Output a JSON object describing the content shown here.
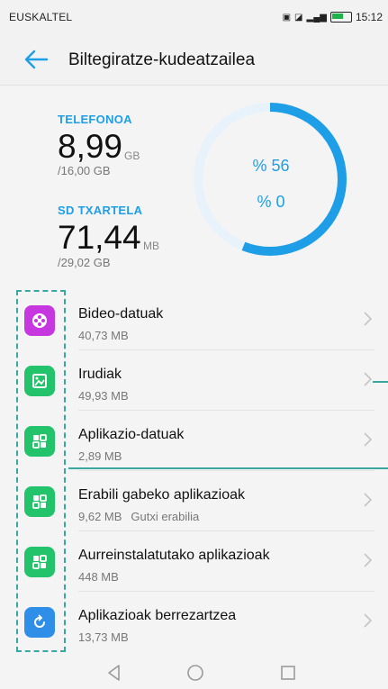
{
  "status_bar": {
    "carrier": "EUSKALTEL",
    "time": "15:12"
  },
  "app_bar": {
    "title": "Biltegiratze-kudeatzailea"
  },
  "storage": {
    "phone": {
      "label": "TELEFONOA",
      "used": "8,99",
      "unit": "GB",
      "total": "/16,00 GB",
      "percent_text": "% 56",
      "percent": 56
    },
    "sd": {
      "label": "SD TXARTELA",
      "used": "71,44",
      "unit": "MB",
      "total": "/29,02 GB",
      "percent_text": "% 0",
      "percent": 0
    }
  },
  "items": [
    {
      "name": "Bideo-datuak",
      "size": "40,73 MB",
      "extra": "",
      "icon": "video-icon",
      "color": "#c637e0"
    },
    {
      "name": "Irudiak",
      "size": "49,93 MB",
      "extra": "",
      "icon": "image-icon",
      "color": "#22c36a"
    },
    {
      "name": "Aplikazio-datuak",
      "size": "2,89 MB",
      "extra": "",
      "icon": "apps-grid-icon",
      "color": "#22c36a"
    },
    {
      "name": "Erabili gabeko aplikazioak",
      "size": "9,62 MB",
      "extra": "Gutxi erabilia",
      "icon": "apps-grid-icon",
      "color": "#22c36a"
    },
    {
      "name": "Aurreinstalatutako aplikazioak",
      "size": "448 MB",
      "extra": "",
      "icon": "apps-grid-icon",
      "color": "#22c36a"
    },
    {
      "name": "Aplikazioak berrezartzea",
      "size": "13,73 MB",
      "extra": "",
      "icon": "reset-icon",
      "color": "#2f8fe8"
    }
  ],
  "colors": {
    "accent": "#1f9ee8",
    "ring_track": "#e8f2fb",
    "annotation": "#3aa8a2"
  }
}
